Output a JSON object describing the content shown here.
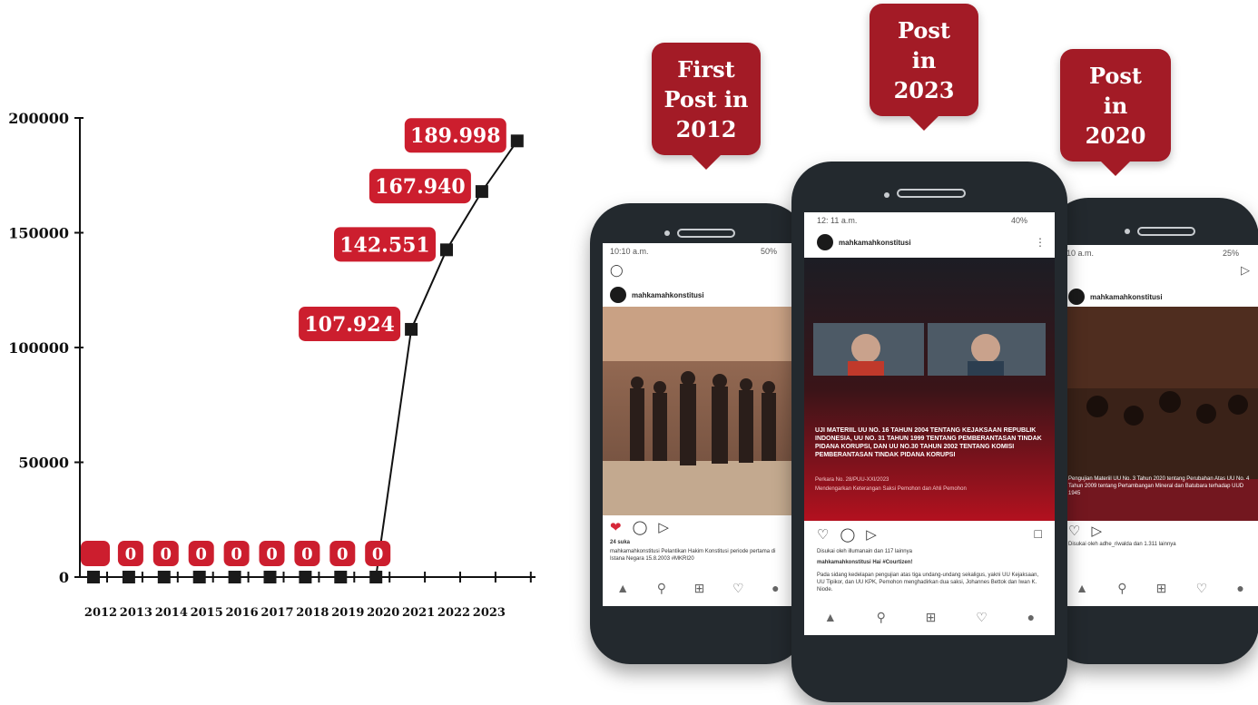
{
  "chart_data": {
    "type": "line",
    "categories": [
      "2012",
      "2013",
      "2014",
      "2015",
      "2016",
      "2017",
      "2018",
      "2019",
      "2020",
      "2021",
      "2022",
      "2023"
    ],
    "values": [
      0,
      0,
      0,
      0,
      0,
      0,
      0,
      0,
      0,
      107924,
      142551,
      167940,
      189998
    ],
    "value_labels": [
      "",
      "0",
      "0",
      "0",
      "0",
      "0",
      "0",
      "0",
      "0",
      "107.924",
      "142.551",
      "167.940",
      "189.998"
    ],
    "yticks": [
      0,
      50000,
      100000,
      150000,
      200000
    ],
    "ylim": [
      0,
      200000
    ],
    "marker_color": "#1a1a1a",
    "label_color": "#cc1e2e"
  },
  "callouts": [
    {
      "text": "First\nPost in\n2012"
    },
    {
      "text": "Post\nin\n2023"
    },
    {
      "text": "Post\nin\n2020"
    }
  ],
  "phones": {
    "left": {
      "time": "10:10 a.m.",
      "battery": "50%",
      "account": "mahkamahkonstitusi",
      "likes": "24 suka",
      "caption": "mahkamahkonstitusi Pelantikan Hakim Konstitusi periode pertama di Istana Negara 15.8.2003 #MKRI20"
    },
    "center": {
      "time": "12: 11 a.m.",
      "battery": "40%",
      "account": "mahkamahkonstitusi",
      "headline": "UJI MATERIIL UU NO. 16 TAHUN 2004 TENTANG KEJAKSAAN REPUBLIK INDONESIA, UU NO. 31 TAHUN 1999 TENTANG PEMBERANTASAN TINDAK PIDANA KORUPSI, DAN UU NO.30 TAHUN 2002 TENTANG KOMISI PEMBERANTASAN TINDAK PIDANA KORUPSI",
      "subline": "Perkara No. 28/PUU-XXI/2023",
      "subline2": "Mendengarkan Keterangan Saksi Pemohon dan Ahli Pemohon",
      "likes": "Disukai oleh illumanain dan 117 lainnya",
      "caption": "mahkamahkonstitusi Hai #Courtizen!",
      "body": "Pada sidang kedelapan pengujian atas tiga undang-undang sekaligus, yakni UU Kejaksaan, UU Tipikor, dan UU KPK, Pemohon menghadirkan dua saksi, Johannes Bettok dan Iwan K. Niode."
    },
    "right": {
      "time": "10 a.m.",
      "battery": "25%",
      "account": "mahkamahkonstitusi",
      "headline": "Pengujian Materiil UU No. 3 Tahun 2020 tentang Perubahan Atas UU No. 4 Tahun 2009 tentang Pertambangan Mineral dan Batubara terhadap UUD 1945",
      "likes": "Disukai oleh adhe_riwalda dan 1.311 lainnya"
    }
  }
}
